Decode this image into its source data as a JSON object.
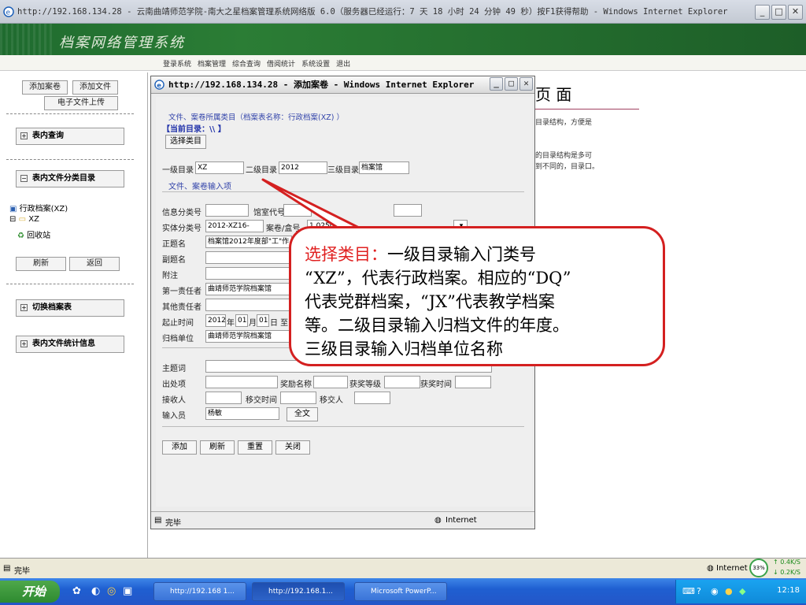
{
  "browser": {
    "title": "http://192.168.134.28 - 云南曲靖师范学院-南大之星档案管理系统网络版 6.0（服务器已经运行：7 天 18 小时 24 分钟 49 秒）按F1获得帮助 - Windows Internet Explorer",
    "status": "完毕",
    "zone": "Internet",
    "net_percent": "33%",
    "net_up": "0.4K/S",
    "net_down": "0.2K/S"
  },
  "app": {
    "title": "档案网络管理系统",
    "menu": [
      "登录系统",
      "档案管理",
      "综合查询",
      "借阅统计",
      "系统设置",
      "退出"
    ]
  },
  "sidebar": {
    "add_case": "添加案卷",
    "add_file": "添加文件",
    "upload": "电子文件上传",
    "panel_query": "表内查询",
    "panel_category": "表内文件分类目录",
    "tree_root": "行政档案(XZ)",
    "tree_child": "XZ",
    "tree_recycle": "回收站",
    "refresh": "刷新",
    "back": "返回",
    "panel_switch": "切换档案表",
    "panel_stats": "表内文件统计信息"
  },
  "dialog": {
    "title": "http://192.168.134.28 - 添加案卷 - Windows Internet Explorer",
    "section_category": "文件、案卷所属类目（档案表名称：行政档案(XZ) ）",
    "current_dir": "【当前目录：\\\\ 】",
    "select_category": "选择类目",
    "level1_label": "一级目录",
    "level1_value": "XZ",
    "level2_label": "二级目录",
    "level2_value": "2012",
    "level3_label": "三级目录",
    "level3_value": "档案馆",
    "section_input": "文件、案卷输入项",
    "info_no": "信息分类号",
    "room_no": "馆室代号",
    "entity_no": "实体分类号",
    "entity_value": "2012-XZ16-",
    "volume_no": "案卷/盒号",
    "volume_value": "1.0250",
    "main_title": "正题名",
    "main_title_value": "档案馆2012年度部\"工\"作",
    "sub_title": "副题名",
    "attach": "附注",
    "resp1": "第一责任者",
    "resp1_value": "曲靖师范学院档案馆",
    "resp_other": "其他责任者",
    "period": "起止时间",
    "year": "2012",
    "year_unit": "年",
    "month": "01",
    "month_unit": "月",
    "day": "01",
    "day_unit": "日 至",
    "archive_unit": "归档单位",
    "archive_unit_value": "曲靖师范学院档案馆",
    "subject": "主题词",
    "origin": "出处项",
    "award_name": "奖励名称",
    "award_level": "获奖等级",
    "award_time": "获奖时间",
    "receiver": "接收人",
    "transfer_time": "移交时间",
    "transferor": "移交人",
    "operator_label": "输入员",
    "operator_value": "杨敏",
    "fulltext": "全文",
    "btn_add": "添加",
    "btn_refresh": "刷新",
    "btn_reset": "重置",
    "btn_close": "关闭",
    "status_done": "完毕",
    "status_zone": "Internet"
  },
  "background": {
    "heading": "页 面",
    "line1": "目录结构，方便是",
    "line2": "的目录结构是多可",
    "line3": "到不同的，目录口。"
  },
  "callout": {
    "highlight": "选择类目：",
    "line1": "一级目录输入门类号",
    "line2": "“XZ”，代表行政档案。相应的“DQ”",
    "line3": "代表党群档案，“JX”代表教学档案",
    "line4": "等。二级目录输入归档文件的年度。",
    "line5": "三级目录输入归档单位名称"
  },
  "taskbar": {
    "start": "开始",
    "task1": "http://192.168 1...",
    "task2": "http://192.168.1...",
    "task3": "Microsoft PowerP...",
    "clock": "12:18"
  }
}
